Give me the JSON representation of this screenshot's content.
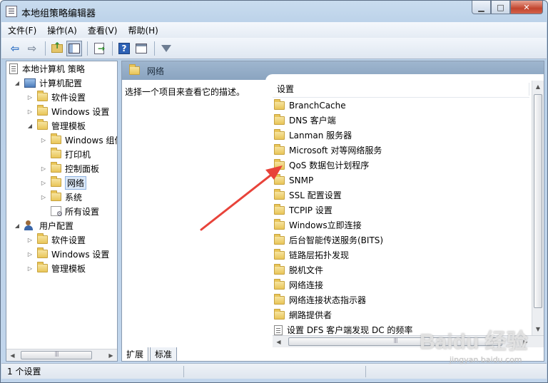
{
  "window": {
    "title": "本地组策略编辑器",
    "min_glyph": "▁",
    "max_glyph": "□",
    "close_glyph": "✕"
  },
  "menu": [
    "文件(F)",
    "操作(A)",
    "查看(V)",
    "帮助(H)"
  ],
  "tree": {
    "root": "本地计算机 策略",
    "computer_config": "计算机配置",
    "software_settings": "软件设置",
    "windows_settings": "Windows 设置",
    "admin_templates": "管理模板",
    "windows_components": "Windows 组件",
    "printers": "打印机",
    "control_panel": "控制面板",
    "network": "网络",
    "system": "系统",
    "all_settings": "所有设置",
    "user_config": "用户配置",
    "user_software_settings": "软件设置",
    "user_windows_settings": "Windows 设置",
    "user_admin_templates": "管理模板"
  },
  "detail": {
    "header_title": "网络",
    "description_hint": "选择一个项目来查看它的描述。",
    "column_header": "设置",
    "items": [
      {
        "label": "BranchCache",
        "icon": "folder-icon"
      },
      {
        "label": "DNS 客户端",
        "icon": "folder-icon"
      },
      {
        "label": "Lanman 服务器",
        "icon": "folder-icon"
      },
      {
        "label": "Microsoft 对等网络服务",
        "icon": "folder-icon"
      },
      {
        "label": "QoS 数据包计划程序",
        "icon": "folder-icon"
      },
      {
        "label": "SNMP",
        "icon": "folder-icon"
      },
      {
        "label": "SSL 配置设置",
        "icon": "folder-icon"
      },
      {
        "label": "TCPIP 设置",
        "icon": "folder-icon"
      },
      {
        "label": "Windows立即连接",
        "icon": "folder-icon"
      },
      {
        "label": "后台智能传送服务(BITS)",
        "icon": "folder-icon"
      },
      {
        "label": "链路层拓扑发现",
        "icon": "folder-icon"
      },
      {
        "label": "脱机文件",
        "icon": "folder-icon"
      },
      {
        "label": "网络连接",
        "icon": "folder-icon"
      },
      {
        "label": "网络连接状态指示器",
        "icon": "folder-icon"
      },
      {
        "label": "網路提供者",
        "icon": "folder-icon"
      },
      {
        "label": "设置 DFS 客户端发现 DC 的频率",
        "icon": "setting-icon"
      }
    ]
  },
  "tabs": {
    "extended": "扩展",
    "standard": "标准"
  },
  "status": {
    "text": "1 个设置"
  },
  "watermark": {
    "main": "Baidu 经验",
    "sub": "jingyan.baidu.com"
  },
  "colors": {
    "annotation_arrow": "#e8433a"
  }
}
